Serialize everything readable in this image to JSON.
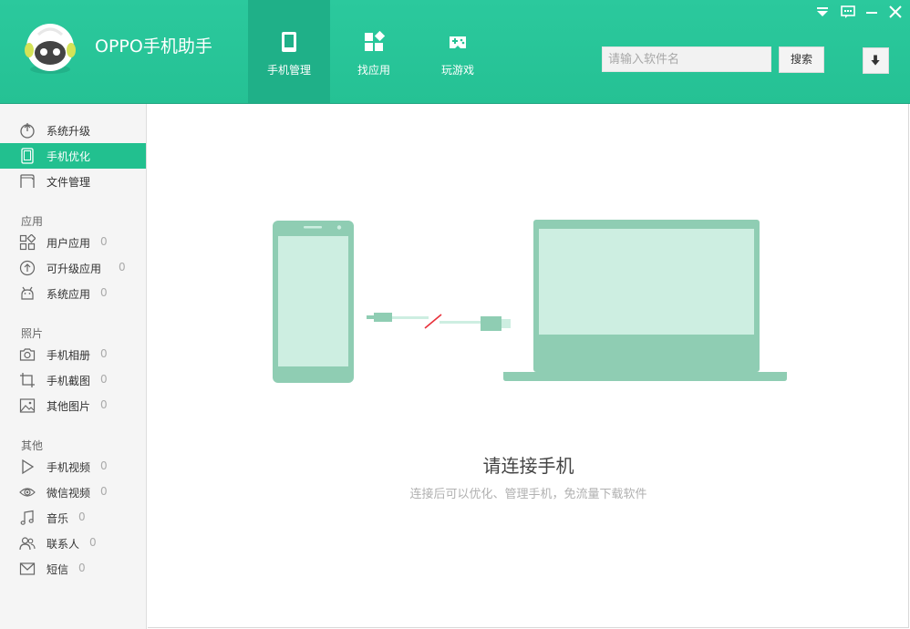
{
  "header": {
    "app_title": "OPPO手机助手",
    "tabs": [
      {
        "label": "手机管理",
        "active": true,
        "icon": "phone-icon"
      },
      {
        "label": "找应用",
        "active": false,
        "icon": "apps-icon"
      },
      {
        "label": "玩游戏",
        "active": false,
        "icon": "gamepad-icon"
      }
    ],
    "search": {
      "placeholder": "请输入软件名",
      "value": ""
    },
    "search_button": "搜索"
  },
  "sidebar": {
    "top_items": [
      {
        "label": "系统升级",
        "icon": "system-upgrade-icon",
        "active": false
      },
      {
        "label": "手机优化",
        "icon": "phone-optimize-icon",
        "active": true
      },
      {
        "label": "文件管理",
        "icon": "folder-icon",
        "active": false
      }
    ],
    "sections": [
      {
        "title": "应用",
        "items": [
          {
            "label": "用户应用",
            "count": "0",
            "icon": "user-apps-icon"
          },
          {
            "label": "可升级应用",
            "count": "0",
            "icon": "upgrade-arrow-icon"
          },
          {
            "label": "系统应用",
            "count": "0",
            "icon": "android-icon"
          }
        ]
      },
      {
        "title": "照片",
        "items": [
          {
            "label": "手机相册",
            "count": "0",
            "icon": "camera-icon"
          },
          {
            "label": "手机截图",
            "count": "0",
            "icon": "crop-icon"
          },
          {
            "label": "其他图片",
            "count": "0",
            "icon": "image-icon"
          }
        ]
      },
      {
        "title": "其他",
        "items": [
          {
            "label": "手机视频",
            "count": "0",
            "icon": "play-icon"
          },
          {
            "label": "微信视频",
            "count": "0",
            "icon": "eye-icon"
          },
          {
            "label": "音乐",
            "count": "0",
            "icon": "music-icon"
          },
          {
            "label": "联系人",
            "count": "0",
            "icon": "contacts-icon"
          },
          {
            "label": "短信",
            "count": "0",
            "icon": "mail-icon"
          }
        ]
      }
    ]
  },
  "main": {
    "headline": "请连接手机",
    "subline": "连接后可以优化、管理手机，免流量下载软件"
  },
  "colors": {
    "brand": "#25c194",
    "active": "#22c08f",
    "illustration": "#8fcdb3",
    "illustration_fill": "#cdeee1",
    "disconnect": "#e8303a"
  }
}
